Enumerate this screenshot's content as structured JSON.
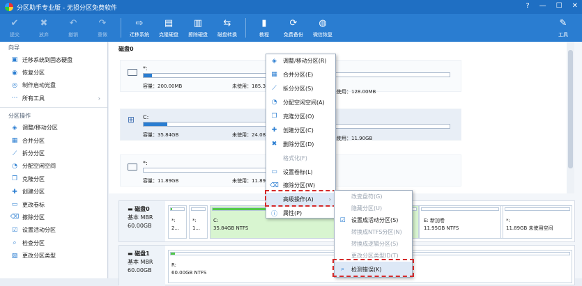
{
  "app": {
    "title": "分区助手专业版 - 无损分区免费软件"
  },
  "toolbar": {
    "buttons": [
      {
        "label": "提交",
        "icon": "check-icon"
      },
      {
        "label": "放弃",
        "icon": "close-icon"
      },
      {
        "label": "撤销",
        "icon": "undo-icon"
      },
      {
        "label": "重做",
        "icon": "redo-icon"
      },
      {
        "label": "迁移系统",
        "icon": "migrate-icon"
      },
      {
        "label": "克隆硬盘",
        "icon": "clone-disk-icon"
      },
      {
        "label": "擦除硬盘",
        "icon": "wipe-disk-icon"
      },
      {
        "label": "磁盘转换",
        "icon": "convert-disk-icon"
      },
      {
        "label": "教程",
        "icon": "book-icon"
      },
      {
        "label": "免费备份",
        "icon": "backup-icon"
      },
      {
        "label": "微信恢复",
        "icon": "wechat-icon"
      }
    ],
    "tools_label": "工具"
  },
  "sidebar": {
    "wizard_header": "向导",
    "wizard_items": [
      "迁移系统到固态硬盘",
      "恢复分区",
      "制作启动光盘",
      "所有工具"
    ],
    "ops_header": "分区操作",
    "ops_items": [
      "调整/移动分区",
      "合并分区",
      "拆分分区",
      "分配空闲空间",
      "克隆分区",
      "创建分区",
      "更改卷标",
      "擦除分区",
      "设置活动分区",
      "检查分区",
      "更改分区类型"
    ]
  },
  "disk0": {
    "header": "磁盘0",
    "parts": [
      {
        "name": "*:",
        "cap_label": "容量：200.00MB",
        "free_label": "未使用：185.3",
        "right_label": "未使用：128.00MB",
        "fill": 0.07
      },
      {
        "name": "C:",
        "cap_label": "容量：35.84GB",
        "free_label": "未使用：24.08",
        "right_label": "未使用：11.90GB",
        "fill": 0.19
      },
      {
        "name": "*:",
        "cap_label": "容量：11.89GB",
        "free_label": "未使用：11.89",
        "right_label": "",
        "fill": 0
      }
    ]
  },
  "lowmap": {
    "disk0": {
      "name": "磁盘0",
      "type": "基本 MBR",
      "size": "60.00GB",
      "blocks": [
        {
          "line1": "*:",
          "line2": "2..."
        },
        {
          "line1": "*:",
          "line2": "1..."
        },
        {
          "line1": "C:",
          "line2": "35.84GB NTFS"
        },
        {
          "line1": "E: 新加卷",
          "line2": "11.95GB NTFS"
        },
        {
          "line1": "*:",
          "line2": "11.89GB 未使用空间"
        }
      ]
    },
    "disk1": {
      "name": "磁盘1",
      "type": "基本 MBR",
      "size": "60.00GB",
      "blocks": [
        {
          "line1": "R:",
          "line2": "60.00GB NTFS"
        }
      ]
    }
  },
  "context_menu": {
    "items": [
      {
        "label": "调整/移动分区(R)",
        "icon": "resize-icon",
        "disabled": false
      },
      {
        "label": "合并分区(E)",
        "icon": "merge-icon",
        "disabled": false
      },
      {
        "label": "拆分分区(S)",
        "icon": "split-icon",
        "disabled": false
      },
      {
        "label": "分配空闲空间(A)",
        "icon": "allocate-icon",
        "disabled": false
      },
      {
        "label": "克隆分区(O)",
        "icon": "clone-icon",
        "disabled": false
      },
      {
        "label": "创建分区(C)",
        "icon": "create-icon",
        "disabled": false
      },
      {
        "label": "删除分区(D)",
        "icon": "delete-icon",
        "disabled": false
      },
      {
        "label": "格式化(F)",
        "icon": "",
        "disabled": true
      },
      {
        "label": "设置卷标(L)",
        "icon": "label-icon",
        "disabled": false
      },
      {
        "label": "擦除分区(W)",
        "icon": "wipe-icon",
        "disabled": false
      },
      {
        "label": "高级操作(A)",
        "icon": "",
        "disabled": false,
        "submenu": true
      },
      {
        "label": "属性(P)",
        "icon": "info-icon",
        "disabled": false
      }
    ]
  },
  "submenu": {
    "items": [
      {
        "label": "改变盘符(G)",
        "disabled": true
      },
      {
        "label": "隐藏分区(U)",
        "disabled": true
      },
      {
        "label": "设置成活动分区(S)",
        "disabled": false,
        "icon": "check-mark-icon"
      },
      {
        "label": "转换成NTFS分区(N)",
        "disabled": true
      },
      {
        "label": "转换成逻辑分区(S)",
        "disabled": true
      },
      {
        "label": "更改分区类型ID(T)",
        "disabled": true
      },
      {
        "label": "检测错误(K)",
        "disabled": false,
        "icon": "magnifier-icon"
      }
    ]
  },
  "colors": {
    "brand": "#2a7dd1",
    "highlight": "#d42a2a",
    "ntfs_used": "#54c94a"
  }
}
